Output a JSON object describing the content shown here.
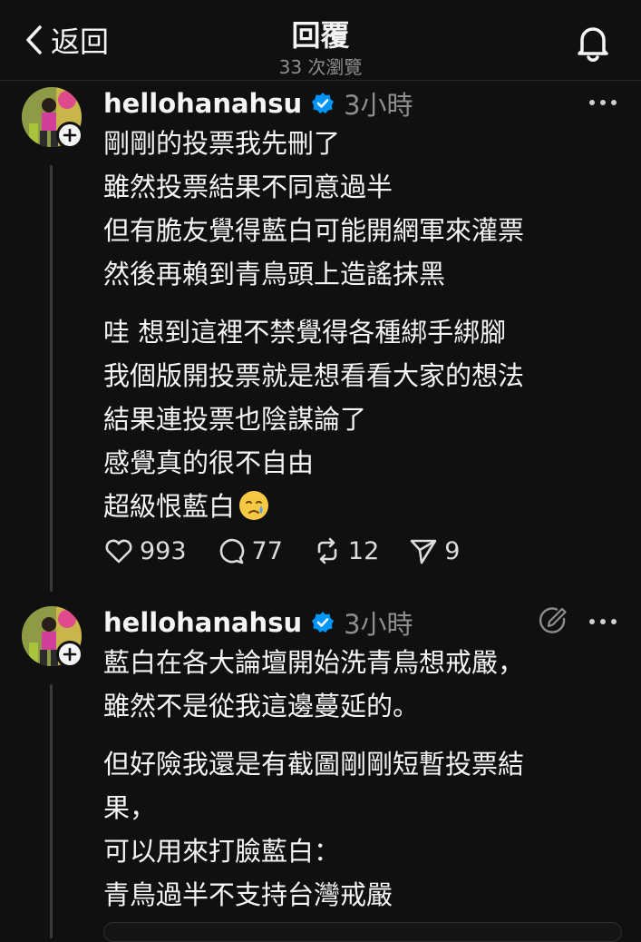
{
  "header": {
    "back_label": "返回",
    "title": "回覆",
    "views": "33 次瀏覽"
  },
  "posts": [
    {
      "username": "hellohanahsu",
      "time": "3小時",
      "paragraphs": [
        [
          "剛剛的投票我先刪了",
          "雖然投票結果不同意過半",
          "但有脆友覺得藍白可能開網軍來灌票",
          "然後再賴到青鳥頭上造謠抹黑"
        ],
        [
          "哇 想到這裡不禁覺得各種綁手綁腳",
          "我個版開投票就是想看看大家的想法",
          "結果連投票也陰謀論了",
          "感覺真的很不自由",
          "超級恨藍白"
        ]
      ],
      "emoji": "crying-face",
      "likes": "993",
      "comments": "77",
      "reposts": "12",
      "shares": "9"
    },
    {
      "username": "hellohanahsu",
      "time": "3小時",
      "paragraphs": [
        [
          "藍白在各大論壇開始洗青鳥想戒嚴，",
          "雖然不是從我這邊蔓延的。"
        ],
        [
          "但好險我還是有截圖剛剛短暫投票結",
          "果，",
          "可以用來打臉藍白：",
          "青鳥過半不支持台灣戒嚴"
        ]
      ]
    }
  ],
  "colors": {
    "background": "#101010",
    "text": "#f3f5f7",
    "muted": "#8e8e8e",
    "verified": "#0095f6"
  }
}
